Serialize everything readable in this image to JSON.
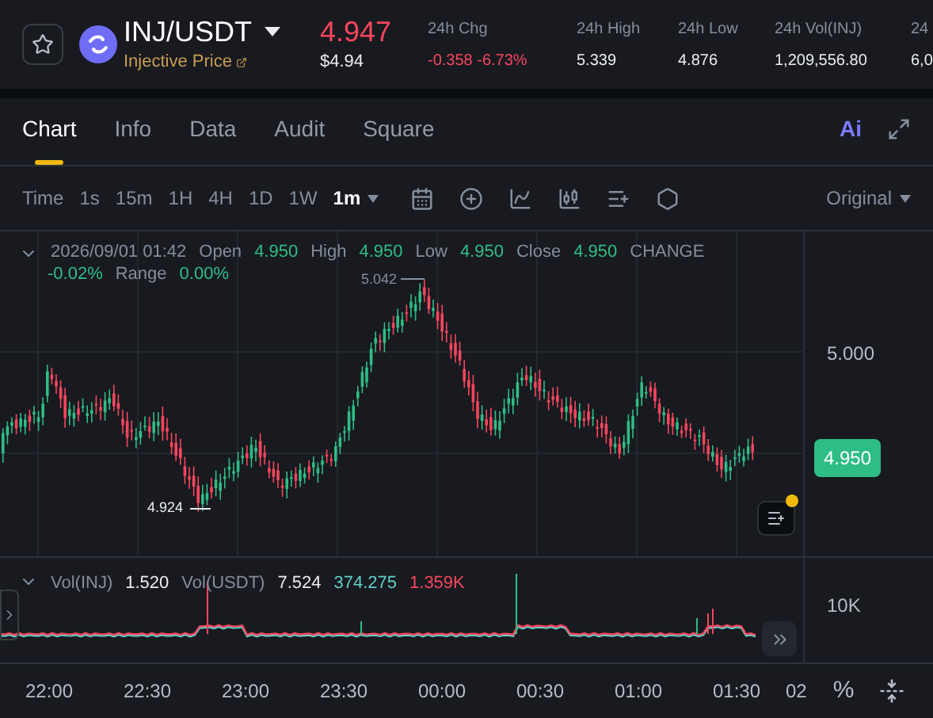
{
  "header": {
    "pair": "INJ/USDT",
    "subtitle": "Injective Price",
    "price": "4.947",
    "price_usd": "$4.94",
    "stats": [
      {
        "label": "24h Chg",
        "value": "-0.358 -6.73%",
        "color": "#f6465d"
      },
      {
        "label": "24h High",
        "value": "5.339",
        "color": "#eaecef"
      },
      {
        "label": "24h Low",
        "value": "4.876",
        "color": "#eaecef"
      },
      {
        "label": "24h Vol(INJ)",
        "value": "1,209,556.80",
        "color": "#eaecef"
      },
      {
        "label": "24",
        "value": "6,0",
        "color": "#eaecef"
      }
    ]
  },
  "tabs": [
    {
      "label": "Chart",
      "selected": true
    },
    {
      "label": "Info",
      "selected": false
    },
    {
      "label": "Data",
      "selected": false
    },
    {
      "label": "Audit",
      "selected": false
    },
    {
      "label": "Square",
      "selected": false
    }
  ],
  "ai_label": "Ai",
  "toolbar": {
    "label": "Time",
    "intervals": [
      {
        "label": "1s",
        "selected": false
      },
      {
        "label": "15m",
        "selected": false
      },
      {
        "label": "1H",
        "selected": false
      },
      {
        "label": "4H",
        "selected": false
      },
      {
        "label": "1D",
        "selected": false
      },
      {
        "label": "1W",
        "selected": false
      },
      {
        "label": "1m",
        "selected": true
      }
    ],
    "view": "Original"
  },
  "legend": {
    "time": "2026/09/01 01:42",
    "fields": [
      {
        "label": "Open",
        "value": "4.950"
      },
      {
        "label": "High",
        "value": "4.950"
      },
      {
        "label": "Low",
        "value": "4.950"
      },
      {
        "label": "Close",
        "value": "4.950"
      }
    ],
    "change_label": "CHANGE",
    "change_value": "-0.02%",
    "range_label": "Range",
    "range_value": "0.00%"
  },
  "price_axis": {
    "level": "5.000",
    "current": "4.950"
  },
  "marks": {
    "high": "5.042",
    "low": "4.924"
  },
  "volume": {
    "label_1": "Vol(INJ)",
    "value_1": "1.520",
    "label_2": "Vol(USDT)",
    "value_2": "7.524",
    "ma_1": "374.275",
    "ma_2": "1.359K",
    "axis": "10K"
  },
  "time_axis": [
    "22:00",
    "22:30",
    "23:00",
    "23:30",
    "00:00",
    "00:30",
    "01:00",
    "01:30",
    "02"
  ],
  "percent_label": "%"
}
